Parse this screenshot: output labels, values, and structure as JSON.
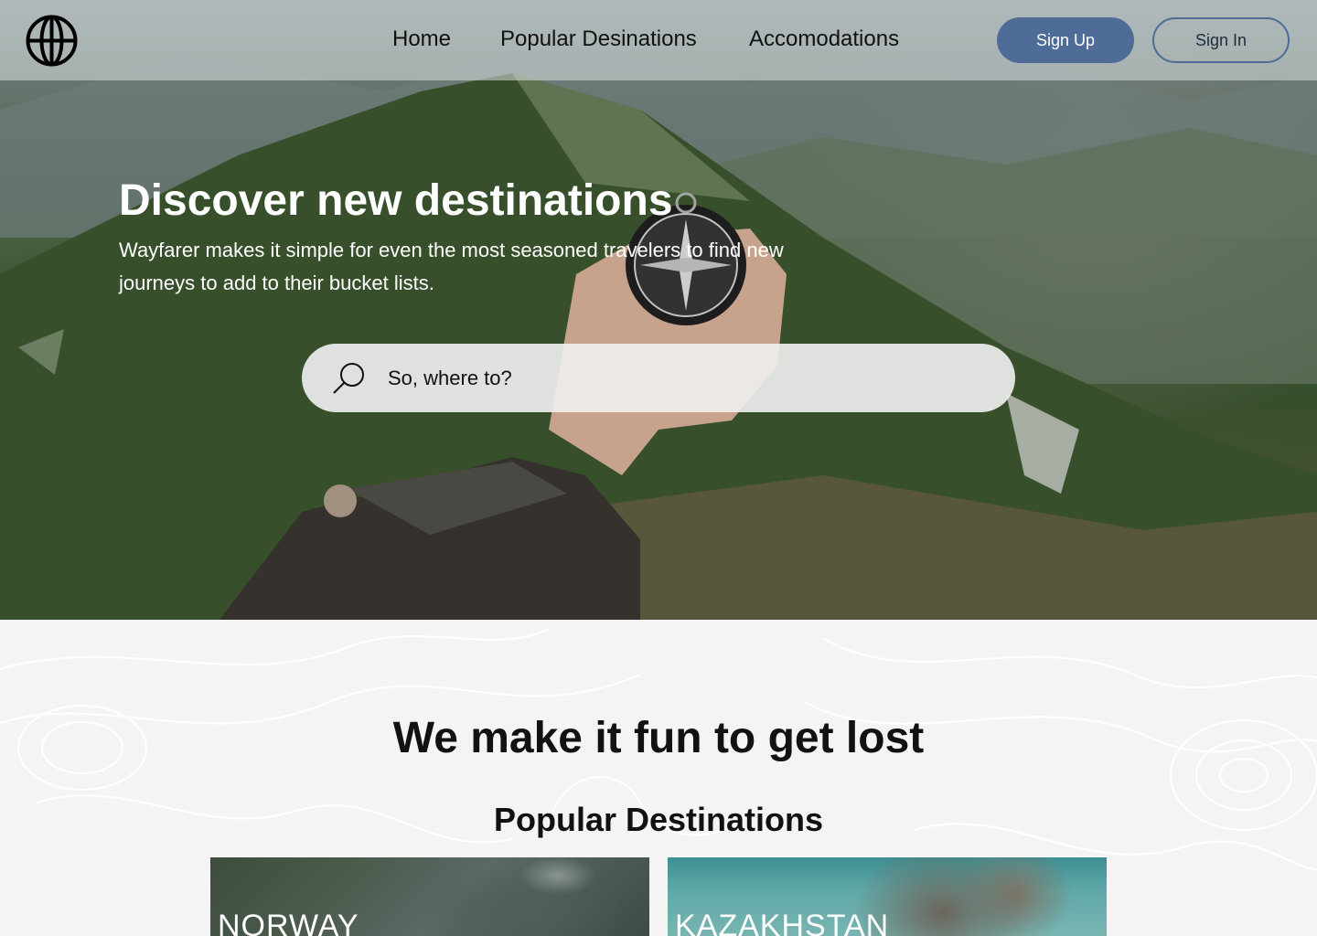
{
  "nav": {
    "links": [
      {
        "label": "Home"
      },
      {
        "label": "Popular Desinations"
      },
      {
        "label": "Accomodations"
      }
    ],
    "signup_label": "Sign Up",
    "signin_label": "Sign In",
    "accent_color": "#4f6b98"
  },
  "hero": {
    "title": "Discover new destinations",
    "subtitle": "Wayfarer makes it simple for even the most seasoned travelers to find new journeys to add to their bucket lists.",
    "search_placeholder": "So, where to?"
  },
  "main": {
    "tagline": "We make it fun to get lost",
    "section_title": "Popular Destinations",
    "destinations": [
      {
        "name": "NORWAY"
      },
      {
        "name": "KAZAKHSTAN"
      }
    ]
  },
  "icons": {
    "logo": "globe-icon",
    "search": "search-icon"
  }
}
